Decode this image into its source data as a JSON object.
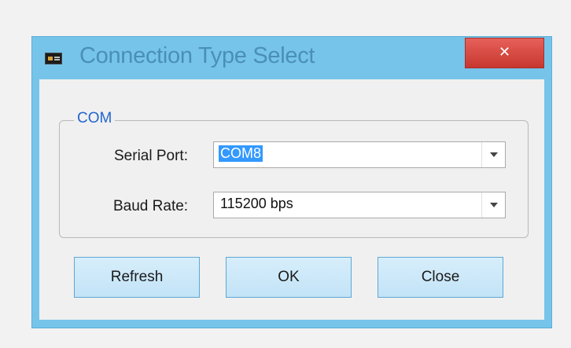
{
  "window": {
    "title": "Connection Type Select",
    "icon": "app-window-icon",
    "close_glyph": "✕"
  },
  "group": {
    "legend": "COM"
  },
  "fields": {
    "serial_port": {
      "label": "Serial Port:",
      "value": "COM8",
      "icon": "chevron-down-icon"
    },
    "baud_rate": {
      "label": "Baud Rate:",
      "value": "115200 bps",
      "icon": "chevron-down-icon"
    }
  },
  "buttons": {
    "refresh": "Refresh",
    "ok": "OK",
    "close": "Close"
  },
  "colors": {
    "frame": "#76c4ea",
    "title_text": "#4a8fb7",
    "close_button": "#d9463e",
    "legend_text": "#2266cc",
    "selection": "#3399ff",
    "button_fill": "#c9e7f8"
  }
}
